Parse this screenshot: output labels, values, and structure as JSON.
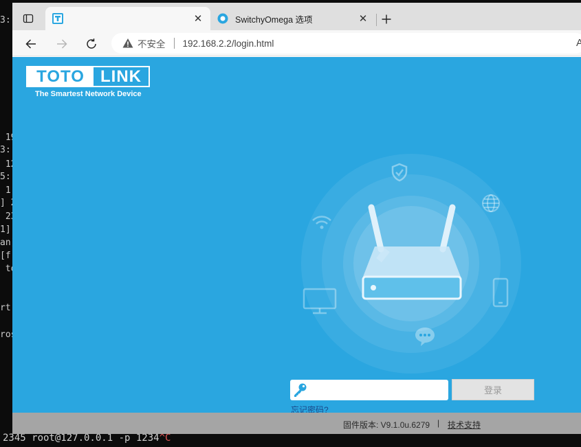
{
  "terminal": {
    "fragments": [
      "3:",
      "",
      "",
      " 19",
      "3:",
      " 12",
      "5:",
      " 1'",
      "] 2",
      " 23",
      "1]:",
      "an)",
      "[f",
      " to",
      "",
      "rt:",
      "",
      "ros"
    ],
    "bottom_line": "2345 root@127.0.0.1 -p 1234",
    "bottom_ctrl": "^C"
  },
  "browser": {
    "tabs": [
      {
        "title": "",
        "active": true,
        "favicon": "totolink-favicon"
      },
      {
        "title": "SwitchyOmega 选项",
        "active": false,
        "favicon": "switchyomega-favicon"
      }
    ],
    "address": {
      "security_label": "不安全",
      "url": "192.168.2.2/login.html",
      "reader_label": "A"
    }
  },
  "page": {
    "logo": {
      "part1": "TOTO",
      "part2": "LINK",
      "slogan": "The Smartest Network Device"
    },
    "login": {
      "password_placeholder": "",
      "button_label": "登录",
      "forgot_label": "忘记密码?"
    },
    "footer": {
      "firmware": "固件版本: V9.1.0u.6279",
      "separator": "|",
      "support": "技术支持"
    }
  },
  "colors": {
    "page_bg": "#2aa6e0",
    "footer_bg": "#a5a5a5",
    "button_bg": "#e3e3e3"
  }
}
